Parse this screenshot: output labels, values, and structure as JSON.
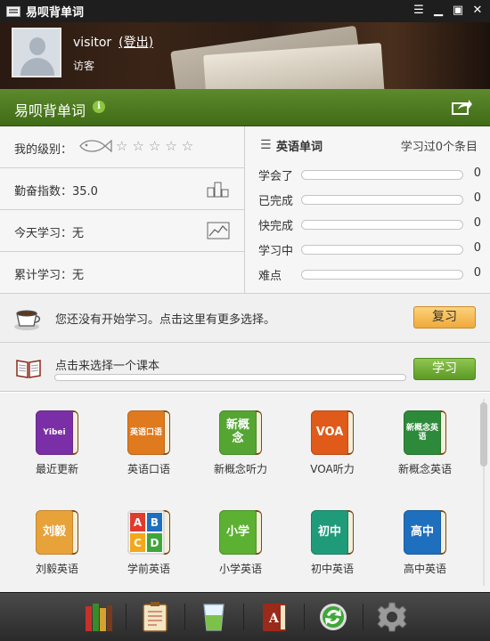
{
  "window": {
    "title": "易呗背单词",
    "controls": [
      "menu",
      "minimize",
      "maximize",
      "close"
    ]
  },
  "user": {
    "name": "visitor",
    "logout_label": "(登出)",
    "type": "访客"
  },
  "header": {
    "title": "易呗背单词",
    "info_icon": "info-icon",
    "share_icon": "share-icon"
  },
  "stats": {
    "level_label": "我的级别：",
    "level_stars": "☆☆☆☆☆",
    "diligence_label": "勤奋指数：35.0",
    "today_label": "今天学习：无",
    "total_label": "累计学习：无"
  },
  "words": {
    "title": "英语单词",
    "studied": "学习过0个条目",
    "progress": [
      {
        "label": "学会了",
        "value": "0",
        "fraction": 0
      },
      {
        "label": "已完成",
        "value": "0",
        "fraction": 0
      },
      {
        "label": "快完成",
        "value": "0",
        "fraction": 0
      },
      {
        "label": "学习中",
        "value": "0",
        "fraction": 0
      },
      {
        "label": "难点",
        "value": "0",
        "fraction": 0
      }
    ]
  },
  "review": {
    "text": "您还没有开始学习。点击这里有更多选择。",
    "button": "复习"
  },
  "course": {
    "text": "点击来选择一个课本",
    "button": "学习",
    "progress": 0
  },
  "books": [
    {
      "label": "最近更新",
      "cover": "Yibei",
      "color": "#7b2fa6"
    },
    {
      "label": "英语口语",
      "cover": "英语口语",
      "color": "#e07a1f"
    },
    {
      "label": "新概念听力",
      "cover": "新概念",
      "color": "#55a532"
    },
    {
      "label": "VOA听力",
      "cover": "VOA",
      "color": "#e05a1a"
    },
    {
      "label": "新概念英语",
      "cover": "新概念英语",
      "color": "#2d8a3a"
    },
    {
      "label": "刘毅英语",
      "cover": "刘毅",
      "color": "#e8a23a"
    },
    {
      "label": "学前英语",
      "cover": "ABCD",
      "color": "#ffffff"
    },
    {
      "label": "小学英语",
      "cover": "小学",
      "color": "#5cb032"
    },
    {
      "label": "初中英语",
      "cover": "初中",
      "color": "#1f9b7a"
    },
    {
      "label": "高中英语",
      "cover": "高中",
      "color": "#1f6fbf"
    }
  ],
  "toolbar": {
    "tools": [
      "library-icon",
      "notebook-icon",
      "glass-icon",
      "dictionary-icon",
      "sync-icon",
      "settings-icon"
    ]
  }
}
